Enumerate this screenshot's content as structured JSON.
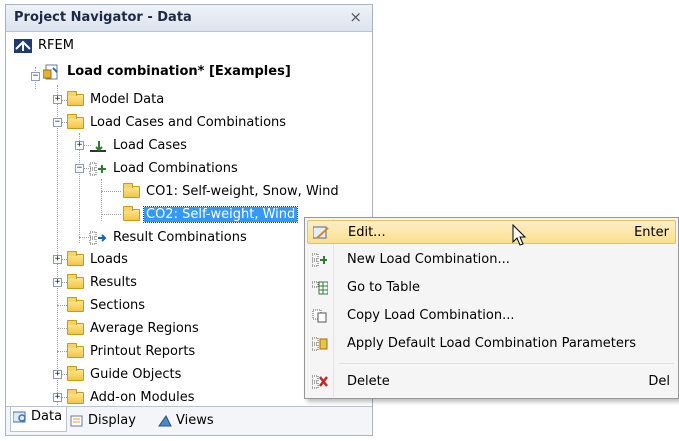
{
  "panel": {
    "title": "Project Navigator - Data",
    "close_glyph": "×"
  },
  "tree": {
    "root": "RFEM",
    "project": "Load combination* [Examples]",
    "model_data": "Model Data",
    "lcc": "Load Cases and Combinations",
    "load_cases": "Load Cases",
    "load_combinations": "Load Combinations",
    "co1": "CO1: Self-weight, Snow, Wind",
    "co2": "CO2: Self-weight, Wind",
    "result_combinations": "Result Combinations",
    "loads": "Loads",
    "results": "Results",
    "sections": "Sections",
    "average_regions": "Average Regions",
    "printout_reports": "Printout Reports",
    "guide_objects": "Guide Objects",
    "addon_modules": "Add-on Modules"
  },
  "tabs": {
    "data": "Data",
    "display": "Display",
    "views": "Views"
  },
  "menu": {
    "edit": "Edit...",
    "edit_key": "Enter",
    "new_lc": "New Load Combination...",
    "go_to_table": "Go to Table",
    "copy_lc": "Copy Load Combination...",
    "apply_default": "Apply Default Load Combination Parameters",
    "delete": "Delete",
    "delete_key": "Del"
  },
  "colors": {
    "selection": "#3399ff",
    "menu_hover": "#fbdf8e",
    "folder": "#f2c54a"
  }
}
